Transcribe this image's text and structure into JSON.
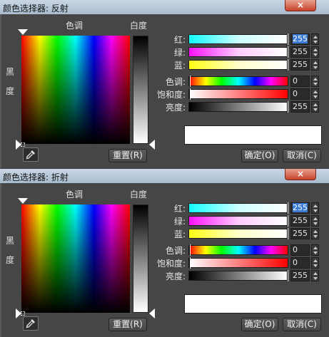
{
  "dialogs": [
    {
      "title": "颜色选择器: 反射",
      "close_label": "×",
      "hue_label": "色调",
      "whiteness_label": "白度",
      "blackness_chars": [
        "黑",
        "度"
      ],
      "rows": [
        {
          "label": "红:",
          "value": "255",
          "selected": true
        },
        {
          "label": "绿:",
          "value": "255"
        },
        {
          "label": "蓝:",
          "value": "255"
        },
        {
          "label": "色调:",
          "value": "0"
        },
        {
          "label": "饱和度:",
          "value": "0"
        },
        {
          "label": "亮度:",
          "value": "255"
        }
      ],
      "reset_label": "重置(R)",
      "ok_label": "确定(O)",
      "cancel_label": "取消(C)",
      "preview_color": "#ffffff"
    },
    {
      "title": "颜色选择器: 折射",
      "close_label": "×",
      "hue_label": "色调",
      "whiteness_label": "白度",
      "blackness_chars": [
        "黑",
        "度"
      ],
      "rows": [
        {
          "label": "红:",
          "value": "255",
          "selected": true
        },
        {
          "label": "绿:",
          "value": "255"
        },
        {
          "label": "蓝:",
          "value": "255"
        },
        {
          "label": "色调:",
          "value": "0"
        },
        {
          "label": "饱和度:",
          "value": "0"
        },
        {
          "label": "亮度:",
          "value": "255"
        }
      ],
      "reset_label": "重置(R)",
      "ok_label": "确定(O)",
      "cancel_label": "取消(C)",
      "preview_color": "#ffffff"
    }
  ]
}
